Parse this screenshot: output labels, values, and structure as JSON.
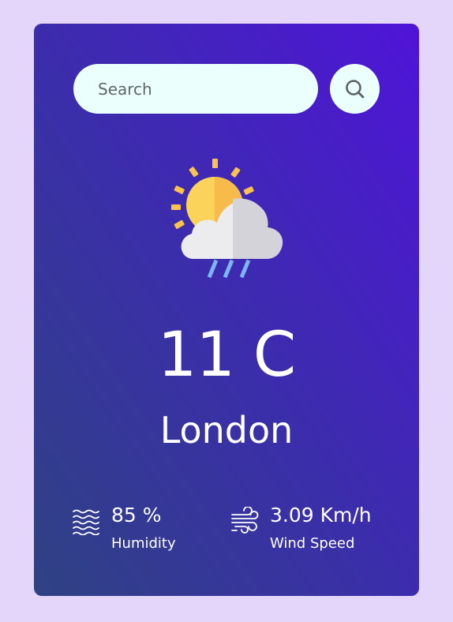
{
  "search": {
    "placeholder": "Search",
    "value": ""
  },
  "icons": {
    "search_button": "search-icon",
    "weather": "partly-cloudy-rain-icon",
    "humidity": "humidity-waves-icon",
    "wind": "wind-icon"
  },
  "weather": {
    "temperature": "11 C",
    "city": "London"
  },
  "details": {
    "humidity": {
      "value": "85 %",
      "label": "Humidity"
    },
    "wind": {
      "value": "3.09 Km/h",
      "label": "Wind Speed"
    }
  },
  "colors": {
    "background": "#e4d6fb",
    "card_gradient_start": "#2f4283",
    "card_gradient_end": "#4f14d8",
    "input_background": "#ebfffc",
    "text": "#ffffff",
    "sun": "#fbd25a",
    "cloud": "#e4e4ea",
    "rain": "#7cb6f5"
  }
}
